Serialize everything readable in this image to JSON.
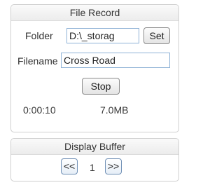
{
  "file_record": {
    "title": "File Record",
    "folder_label": "Folder",
    "folder_value": "D:\\_storag",
    "set_label": "Set",
    "filename_label": "Filename",
    "filename_value": "Cross Road",
    "stop_label": "Stop",
    "elapsed_time": "0:00:10",
    "file_size": "7.0MB"
  },
  "display_buffer": {
    "title": "Display Buffer",
    "prev_label": "<<",
    "page": "1",
    "next_label": ">>"
  }
}
